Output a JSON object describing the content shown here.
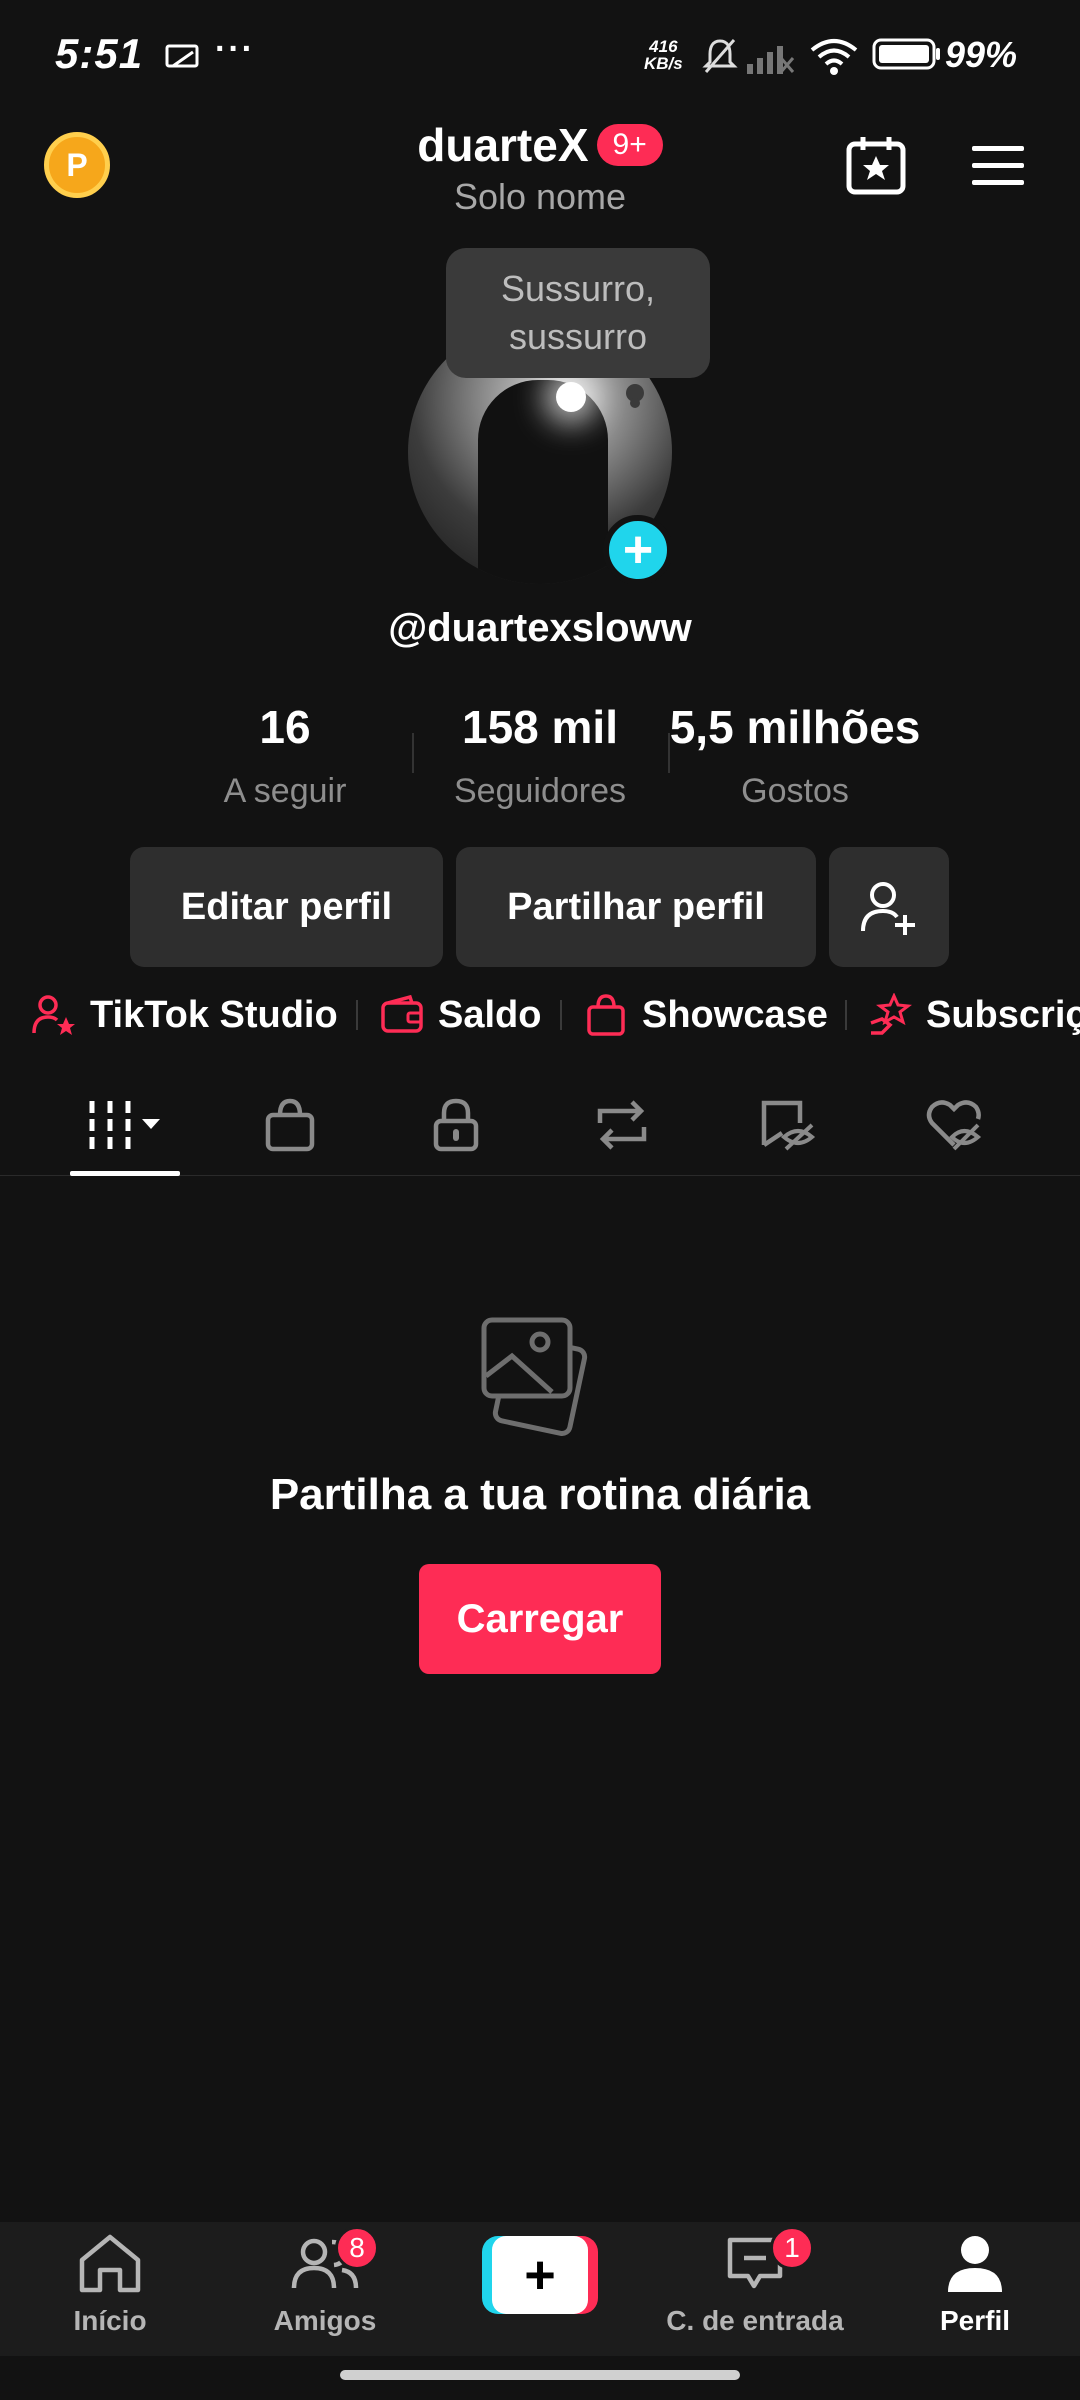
{
  "status_bar": {
    "time": "5:51",
    "dots": "···",
    "net_speed_value": "416",
    "net_speed_unit": "KB/s",
    "battery": "99%"
  },
  "header": {
    "coin_label": "P",
    "username": "duarteX",
    "notif_badge": "9+",
    "subtitle": "Solo nome"
  },
  "profile": {
    "bubble_text": "Sussurro, sussurro",
    "handle": "@duartexsloww",
    "stats": [
      {
        "value": "16",
        "label": "A seguir"
      },
      {
        "value": "158 mil",
        "label": "Seguidores"
      },
      {
        "value": "5,5 milhões",
        "label": "Gostos"
      }
    ],
    "edit_button": "Editar perfil",
    "share_button": "Partilhar perfil"
  },
  "shortcuts": [
    {
      "label": "TikTok Studio",
      "icon": "person-star-icon"
    },
    {
      "label": "Saldo",
      "icon": "wallet-icon"
    },
    {
      "label": "Showcase",
      "icon": "shopping-bag-icon"
    },
    {
      "label": "Subscriç",
      "icon": "star-hand-icon"
    }
  ],
  "tabs": [
    "videos-grid-icon",
    "shop-bag-icon",
    "lock-icon",
    "repost-icon",
    "hidden-tag-icon",
    "hidden-heart-icon"
  ],
  "empty_state": {
    "text": "Partilha a tua rotina diária",
    "button": "Carregar"
  },
  "bottom_nav": {
    "home": "Início",
    "friends": "Amigos",
    "friends_badge": "8",
    "create": "+",
    "inbox": "C. de entrada",
    "inbox_badge": "1",
    "profile": "Perfil"
  },
  "colors": {
    "background": "#121212",
    "accent": "#fe2c55",
    "cyan": "#20d5ec",
    "button_bg": "#2e2e2e"
  }
}
